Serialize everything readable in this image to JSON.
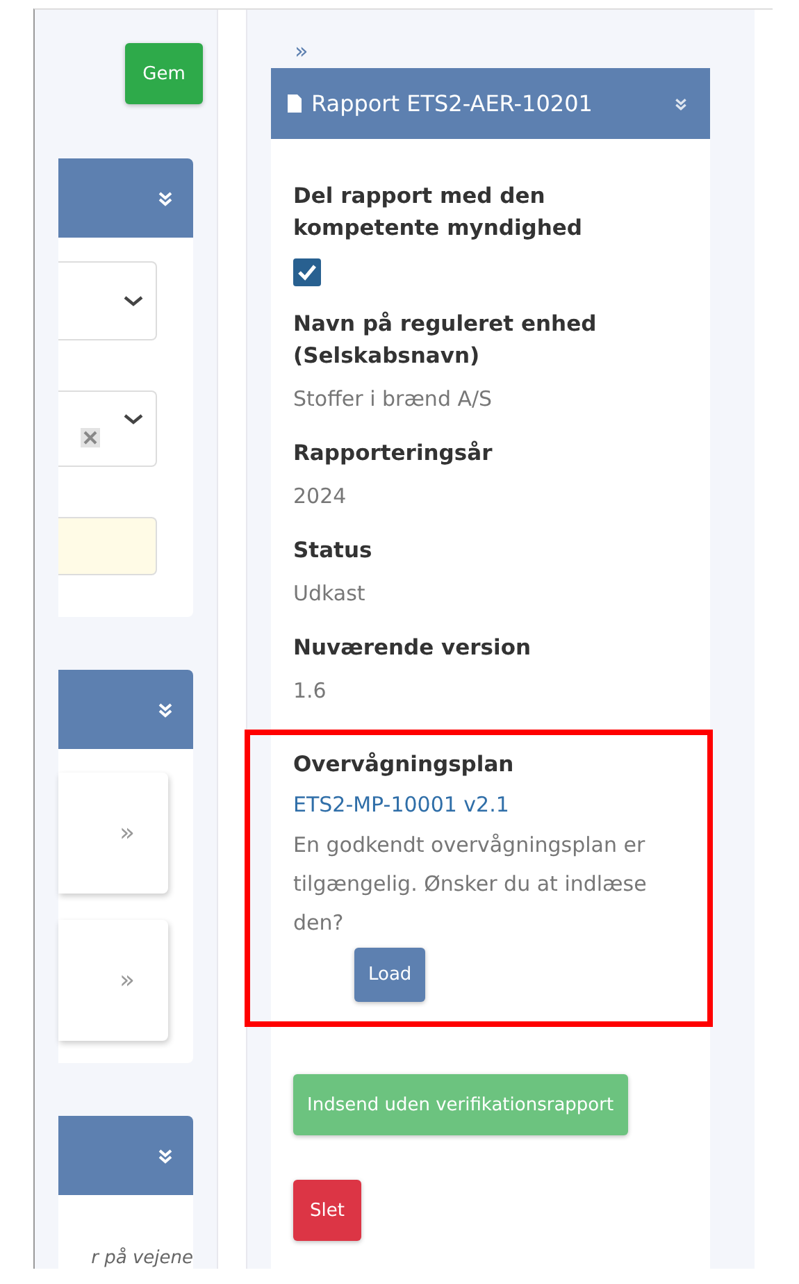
{
  "left_column": {
    "save_button": "Gem",
    "panels": [
      {
        "kind": "form",
        "fields": [
          {
            "kind": "select",
            "clearable": false
          },
          {
            "kind": "select",
            "clearable": true
          },
          {
            "kind": "input",
            "highlighted": true
          }
        ]
      },
      {
        "kind": "links",
        "cards": [
          {
            "arrow": "»"
          },
          {
            "arrow": "»"
          }
        ]
      },
      {
        "kind": "note",
        "text": "r på vejene"
      }
    ]
  },
  "report_panel": {
    "expand_arrow": "»",
    "title": "Rapport ETS2-AER-10201",
    "fields": [
      {
        "kind": "checkbox",
        "label": "Del rapport med den kompetente myndighed",
        "checked": true
      },
      {
        "kind": "text",
        "label": "Navn på reguleret enhed (Selskabsnavn)",
        "value": "Stoffer i brænd A/S"
      },
      {
        "kind": "text",
        "label": "Rapporteringsår",
        "value": "2024"
      },
      {
        "kind": "text",
        "label": "Status",
        "value": "Udkast"
      },
      {
        "kind": "text",
        "label": "Nuværende version",
        "value": "1.6"
      },
      {
        "kind": "plan",
        "label": "Overvågningsplan",
        "link": "ETS2-MP-10001 v2.1",
        "message": "En godkendt overvågningsplan er tilgængelig. Ønsker du at indlæse den?",
        "button": "Load",
        "highlighted": true
      }
    ],
    "buttons": [
      {
        "kind": "submit",
        "label": "Indsend uden verifikationsrapport"
      },
      {
        "kind": "delete",
        "label": "Slet"
      }
    ]
  }
}
